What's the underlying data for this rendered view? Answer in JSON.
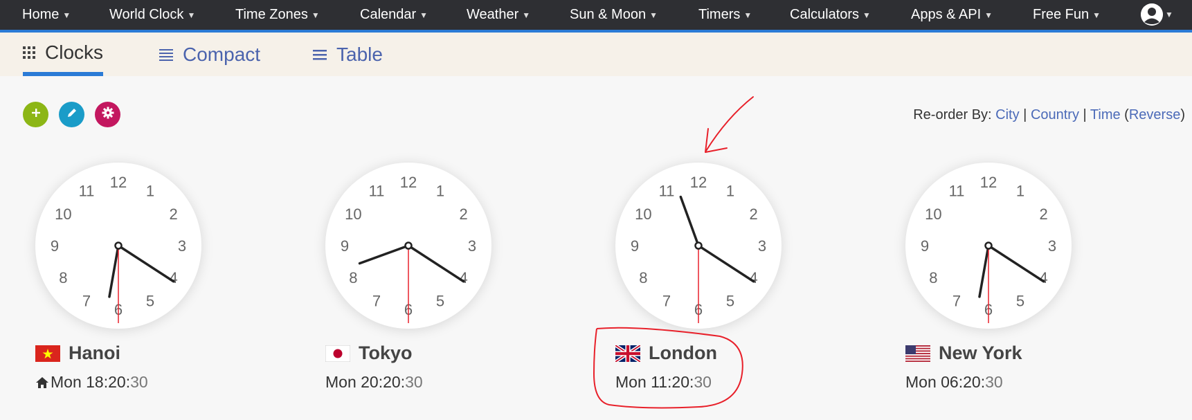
{
  "nav": {
    "items": [
      "Home",
      "World Clock",
      "Time Zones",
      "Calendar",
      "Weather",
      "Sun & Moon",
      "Timers",
      "Calculators",
      "Apps & API",
      "Free Fun"
    ]
  },
  "tabs": {
    "clocks": "Clocks",
    "compact": "Compact",
    "table": "Table"
  },
  "actions": {
    "add_color": "#8cb616",
    "edit_color": "#1a9cc8",
    "settings_color": "#c3175f"
  },
  "reorder": {
    "label": "Re-order By:",
    "city": "City",
    "country": "Country",
    "time": "Time",
    "reverse": "Reverse"
  },
  "clocks": [
    {
      "city": "Hanoi",
      "flag": "vietnam-flag",
      "day": "Mon",
      "hm": "18:20",
      "sec": "30",
      "home": true,
      "hour": 18,
      "minute": 20,
      "second": 30
    },
    {
      "city": "Tokyo",
      "flag": "japan-flag",
      "day": "Mon",
      "hm": "20:20",
      "sec": "30",
      "home": false,
      "hour": 20,
      "minute": 20,
      "second": 30
    },
    {
      "city": "London",
      "flag": "uk-flag",
      "day": "Mon",
      "hm": "11:20",
      "sec": "30",
      "home": false,
      "hour": 11,
      "minute": 20,
      "second": 30
    },
    {
      "city": "New York",
      "flag": "us-flag",
      "day": "Mon",
      "hm": "06:20",
      "sec": "30",
      "home": false,
      "hour": 6,
      "minute": 20,
      "second": 30
    }
  ],
  "annotation_color": "#e8202a"
}
